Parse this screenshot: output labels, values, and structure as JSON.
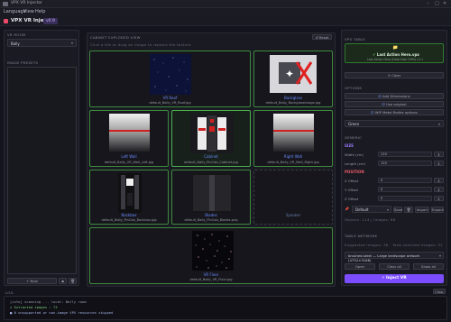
{
  "window": {
    "title": "VPX VR Injector"
  },
  "menu": [
    "Language",
    "View",
    "Help"
  ],
  "app": {
    "title": "VPX VR Injector",
    "version": "v0.9"
  },
  "left": {
    "vr_room_label": "VR ROOM",
    "vr_room_value": "Bally",
    "image_presets_label": "IMAGE PRESETS",
    "new_label": "+ New"
  },
  "center": {
    "panel_label": "CABINET EXPLODED VIEW",
    "reset_label": "↺ Reset",
    "hint": "Click a tile or drag an image to replace the texture",
    "tiles": [
      {
        "name": "VR Roof",
        "file": "default_Bally_VR_Roof.jpg"
      },
      {
        "name": "Backglass",
        "file": "default_Bally_Backglassimage.jpg"
      },
      {
        "name": "Left Wall",
        "file": "default_Bally_VR_Wall_Left.jpg"
      },
      {
        "name": "Cabinet",
        "file": "default_Bally_PinCab_Cabinet.jpg"
      },
      {
        "name": "Right Wall",
        "file": "default_Bally_VR_Wall_Right.jpg"
      },
      {
        "name": "Backbox",
        "file": "default_Bally_PinCab_Backbox.jpg"
      },
      {
        "name": "Blades",
        "file": "default_Bally_PinCab_Blades.png"
      },
      {
        "name": "Speaker",
        "file": ""
      },
      {
        "name": "VR Floor",
        "file": "default_Bally_VR_Floor.jpg"
      }
    ]
  },
  "right": {
    "vpx_table_label": "VPX TABLE",
    "table_name": "Last Action Hero.vpx",
    "table_sub": "Last Action Hero (Data East 1993) v1.1",
    "clear_label": "✕ Clear",
    "options_label": "OPTIONS",
    "opt1": "Add Dimensions",
    "opt2": "Use original",
    "opt3": "WIP Metal Rodhe options",
    "colour_value": "Green",
    "generic_label": "GENERIC",
    "size_label": "SIZE",
    "width_label": "Width (cm)",
    "length_label": "Length (cm)",
    "width_value": "120",
    "length_value": "120",
    "position_label": "POSITION",
    "xoff_label": "X Offset",
    "yoff_label": "Y Offset",
    "zoff_label": "Z Offset",
    "xoff_value": "0",
    "yoff_value": "0",
    "zoff_value": "0",
    "preset_value": "Default",
    "save_label": "Save",
    "import_label": "Import",
    "export_label": "Export",
    "objects_text": "Objects: 114 | Images: 88",
    "network_label": "TABLE NETWORK",
    "suggested_text": "Suggested images: 36 · Total selected images: 51",
    "network_value": "brushed-steel — Large landscape artwork (4752×3168)",
    "open_label": "Open",
    "clear_list_label": "Clear all",
    "show_all_label": "Show all",
    "inject_label": "Inject VR"
  },
  "log": {
    "label": "LOG",
    "clear_label": "Clear",
    "lines": [
      "[info] scanning ... local: Bally room",
      "  ✔ Extracted images : 73",
      "  ■ 0 unsupported or non-image VPX resources skipped"
    ]
  },
  "colors": {
    "accent": "#7c4dff",
    "tile_border": "#3e8a3e",
    "red": "#e83a4a",
    "highlight": "#2a7a2a"
  }
}
